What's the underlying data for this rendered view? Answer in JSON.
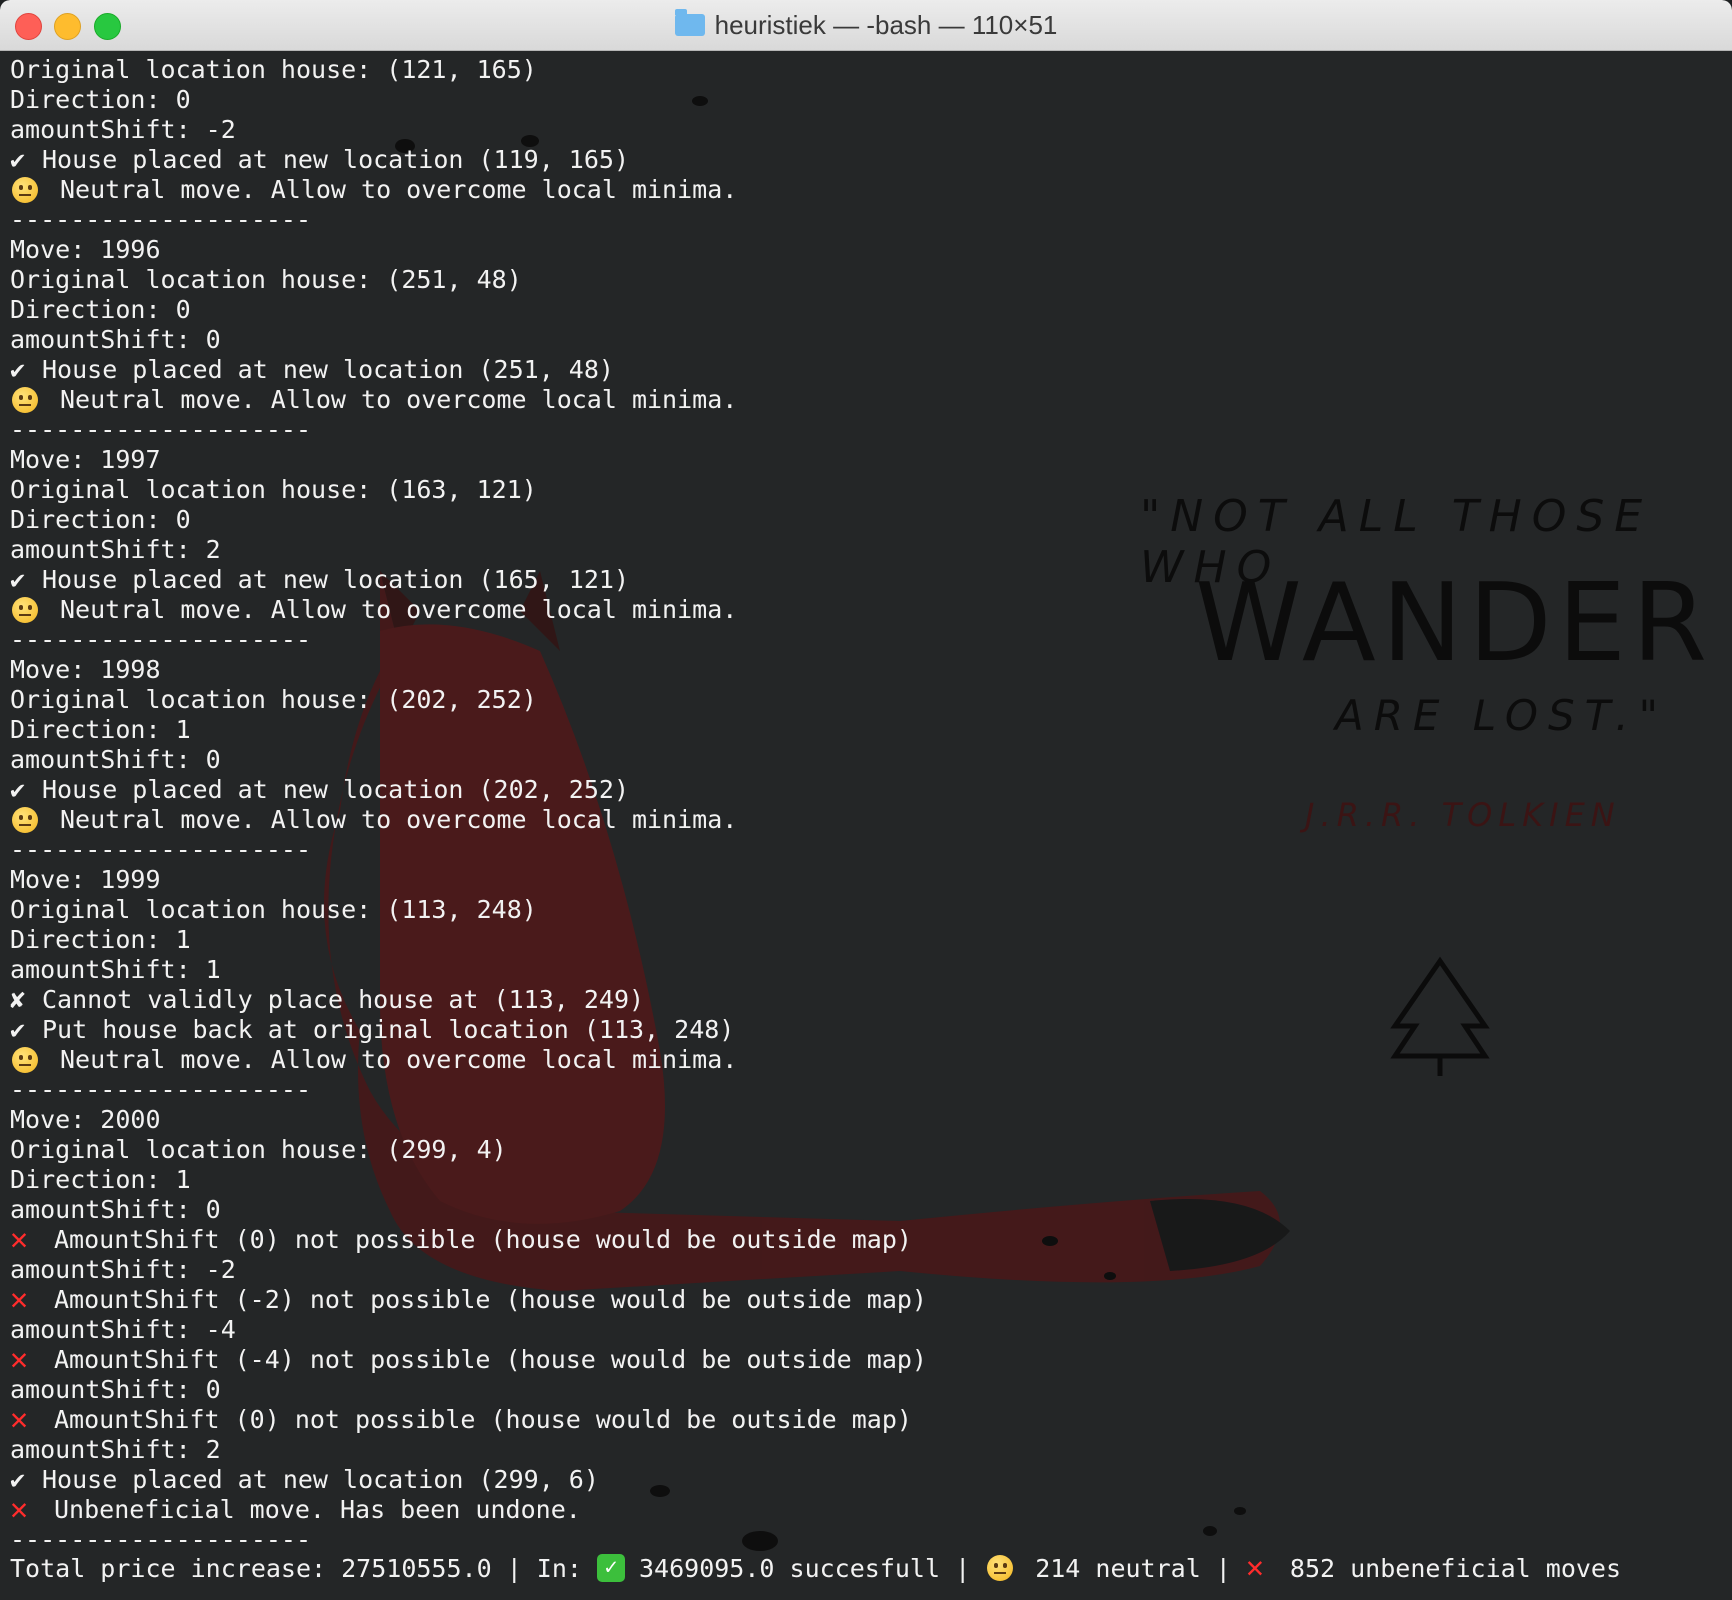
{
  "window": {
    "title": "heuristiek — -bash — 110×51"
  },
  "quote": {
    "line1": "\"NOT ALL THOSE WHO",
    "line2": "WANDER",
    "line3": "ARE LOST.\"",
    "author": "J.R.R. TOLKIEN"
  },
  "lines": [
    {
      "type": "text",
      "text": "Original location house: (121, 165)"
    },
    {
      "type": "text",
      "text": "Direction: 0"
    },
    {
      "type": "text",
      "text": "amountShift: -2"
    },
    {
      "type": "check",
      "icon": "check-icon",
      "text": "House placed at new location (119, 165)"
    },
    {
      "type": "neutral",
      "icon": "neutral-face-icon",
      "text": "Neutral move. Allow to overcome local minima."
    },
    {
      "type": "text",
      "text": "--------------------"
    },
    {
      "type": "text",
      "text": "Move: 1996"
    },
    {
      "type": "text",
      "text": "Original location house: (251, 48)"
    },
    {
      "type": "text",
      "text": "Direction: 0"
    },
    {
      "type": "text",
      "text": "amountShift: 0"
    },
    {
      "type": "check",
      "icon": "check-icon",
      "text": "House placed at new location (251, 48)"
    },
    {
      "type": "neutral",
      "icon": "neutral-face-icon",
      "text": "Neutral move. Allow to overcome local minima."
    },
    {
      "type": "text",
      "text": "--------------------"
    },
    {
      "type": "text",
      "text": "Move: 1997"
    },
    {
      "type": "text",
      "text": "Original location house: (163, 121)"
    },
    {
      "type": "text",
      "text": "Direction: 0"
    },
    {
      "type": "text",
      "text": "amountShift: 2"
    },
    {
      "type": "check",
      "icon": "check-icon",
      "text": "House placed at new location (165, 121)"
    },
    {
      "type": "neutral",
      "icon": "neutral-face-icon",
      "text": "Neutral move. Allow to overcome local minima."
    },
    {
      "type": "text",
      "text": "--------------------"
    },
    {
      "type": "text",
      "text": "Move: 1998"
    },
    {
      "type": "text",
      "text": "Original location house: (202, 252)"
    },
    {
      "type": "text",
      "text": "Direction: 1"
    },
    {
      "type": "text",
      "text": "amountShift: 0"
    },
    {
      "type": "check",
      "icon": "check-icon",
      "text": "House placed at new location (202, 252)"
    },
    {
      "type": "neutral",
      "icon": "neutral-face-icon",
      "text": "Neutral move. Allow to overcome local minima."
    },
    {
      "type": "text",
      "text": "--------------------"
    },
    {
      "type": "text",
      "text": "Move: 1999"
    },
    {
      "type": "text",
      "text": "Original location house: (113, 248)"
    },
    {
      "type": "text",
      "text": "Direction: 1"
    },
    {
      "type": "text",
      "text": "amountShift: 1"
    },
    {
      "type": "cross",
      "icon": "cross-mark-icon",
      "text": "Cannot validly place house at (113, 249)"
    },
    {
      "type": "check",
      "icon": "check-icon",
      "text": "Put house back at original location (113, 248)"
    },
    {
      "type": "neutral",
      "icon": "neutral-face-icon",
      "text": "Neutral move. Allow to overcome local minima."
    },
    {
      "type": "text",
      "text": "--------------------"
    },
    {
      "type": "text",
      "text": "Move: 2000"
    },
    {
      "type": "text",
      "text": "Original location house: (299, 4)"
    },
    {
      "type": "text",
      "text": "Direction: 1"
    },
    {
      "type": "text",
      "text": "amountShift: 0"
    },
    {
      "type": "redx",
      "icon": "red-x-icon",
      "text": "AmountShift (0) not possible (house would be outside map)"
    },
    {
      "type": "text",
      "text": "amountShift: -2"
    },
    {
      "type": "redx",
      "icon": "red-x-icon",
      "text": "AmountShift (-2) not possible (house would be outside map)"
    },
    {
      "type": "text",
      "text": "amountShift: -4"
    },
    {
      "type": "redx",
      "icon": "red-x-icon",
      "text": "AmountShift (-4) not possible (house would be outside map)"
    },
    {
      "type": "text",
      "text": "amountShift: 0"
    },
    {
      "type": "redx",
      "icon": "red-x-icon",
      "text": "AmountShift (0) not possible (house would be outside map)"
    },
    {
      "type": "text",
      "text": "amountShift: 2"
    },
    {
      "type": "check",
      "icon": "check-icon",
      "text": "House placed at new location (299, 6)"
    },
    {
      "type": "redx",
      "icon": "red-x-icon",
      "text": "Unbeneficial move. Has been undone."
    },
    {
      "type": "text",
      "text": "--------------------"
    }
  ],
  "footer": {
    "total": "Total price increase: 27510555.0 | In: ",
    "successful": "3469095.0 succesfull | ",
    "neutral": "214 neutral | ",
    "unbeneficial": "852 unbeneficial moves"
  }
}
